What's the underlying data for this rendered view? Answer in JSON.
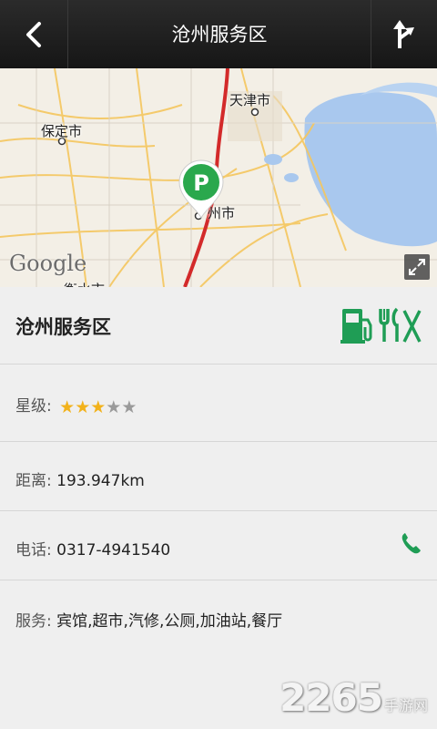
{
  "header": {
    "title": "沧州服务区",
    "back_icon": "back-arrow-icon",
    "nav_icon": "route-turn-icon"
  },
  "map": {
    "labels": {
      "tianjin": "天津市",
      "baoding": "保定市",
      "cangzhou": "州市",
      "bottom": "衡水市"
    },
    "logo": "Google",
    "marker_letter": "P",
    "marker_color": "#2aa84d",
    "route_color": "#d32a2a"
  },
  "detail": {
    "name": "沧州服务区",
    "service_icons": [
      "gas-station-icon",
      "restaurant-icon"
    ],
    "rating": {
      "label": "星级:",
      "value": 3,
      "max": 5
    },
    "distance": {
      "label": "距离:",
      "value": "193.947km"
    },
    "phone": {
      "label": "电话:",
      "value": "0317-4941540"
    },
    "services": {
      "label": "服务:",
      "value": "宾馆,超市,汽修,公厕,加油站,餐厅"
    }
  },
  "watermark": {
    "number": "2265",
    "text": "手游网"
  },
  "colors": {
    "accent": "#1f9d55",
    "star_on": "#f2b21b",
    "star_off": "#9a9a9a"
  }
}
